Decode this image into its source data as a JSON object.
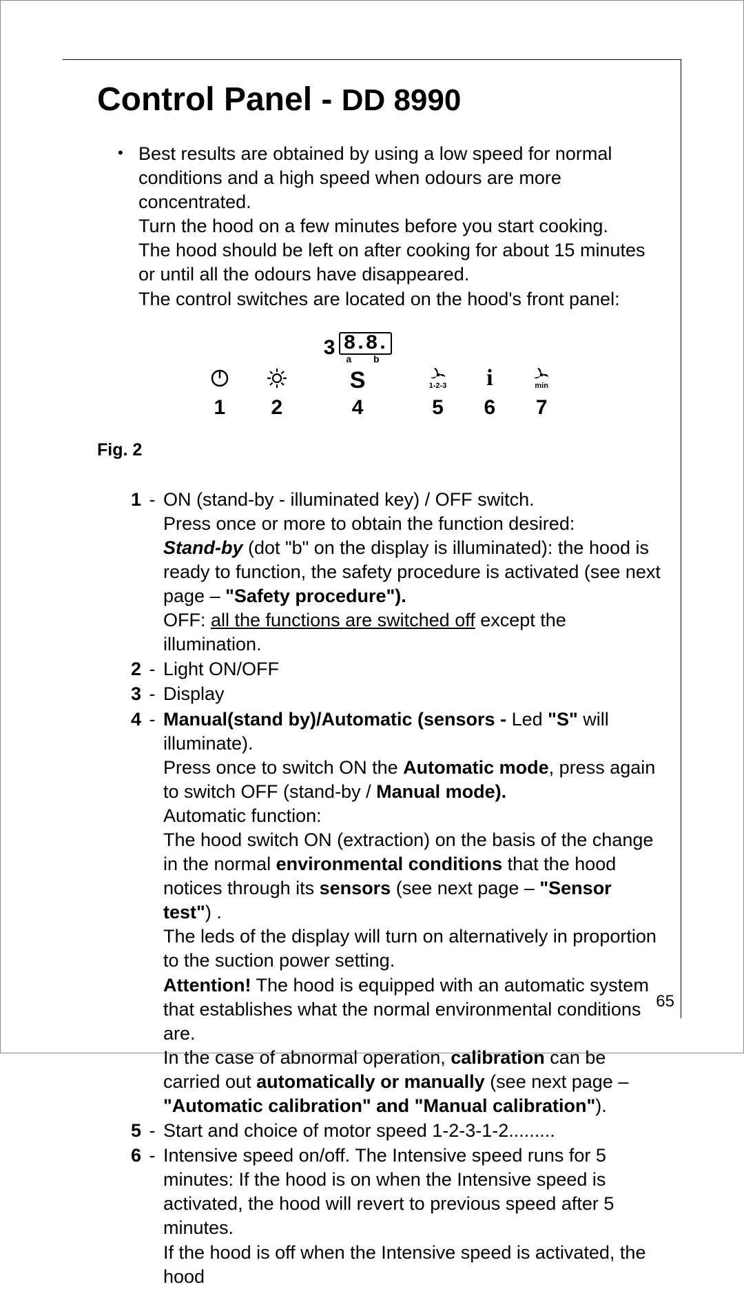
{
  "title_pre": "Control Panel - ",
  "title_model": "DD 8990",
  "intro": "Best results are obtained by using a low speed for normal conditions and a high speed when odours are more concentrated.\nTurn the hood on a few minutes before you start cooking.\nThe hood should be left on after cooking for about 15 minutes or until all the odours have disappeared.\nThe control switches are located on the hood's front panel:",
  "fig": {
    "display_segments": "8.8.",
    "ab": "a b",
    "labels": {
      "n1": "1",
      "n2": "2",
      "n3": "3",
      "n4": "4",
      "n5": "5",
      "n6": "6",
      "n7": "7"
    },
    "s": "S",
    "i": "i",
    "fan123": "1-2-3",
    "fanmin": "min"
  },
  "fig_caption": "Fig. 2",
  "items": {
    "1": {
      "num": "1",
      "l1": "ON (stand-by - illuminated key) / OFF switch.",
      "l2": "Press once or more to obtain the function desired:",
      "sb": "Stand-by",
      "l3a": " (dot \"b\" on the display is illuminated): the hood is ready to function, the safety procedure is activated (see next page – ",
      "sp": "\"Safety procedure\"",
      "l3b": ").",
      "off": "OFF: ",
      "offu": "all the functions are switched off",
      "off2": " except the illumination."
    },
    "2": {
      "num": "2",
      "text": "Light ON/OFF"
    },
    "3": {
      "num": "3",
      "text": "Display"
    },
    "4": {
      "num": "4",
      "b1": "Manual(stand by)/Automatic (sensors - ",
      "t1": "Led ",
      "b1s": "\"S\"",
      "t1b": " will illuminate).",
      "t2": "Press once to switch ON the ",
      "b2": "Automatic mode",
      "t2b": ", press again to switch OFF (stand-by / ",
      "b2c": "Manual mode).",
      "t3": "Automatic function:",
      "t4a": "The hood switch ON (extraction) on the basis of the change in the normal ",
      "b4": "environmental conditions",
      "t4b": " that the hood notices through its ",
      "b4s": "sensors",
      "t4c": " (see next page – ",
      "b4st": "\"Sensor test\"",
      "t4d": ") .",
      "t5": "The leds of the display will turn on alternatively in proportion to the suction power setting.",
      "batt": "Attention!",
      "t6": "  The hood is equipped with an automatic system that establishes what the normal environmental conditions are.",
      "t7a": "In the case of abnormal operation, ",
      "bcal": "calibration",
      "t7b": " can be carried out ",
      "bauto": "automatically or manually",
      "t7c": " (see next page – ",
      "bauto2": "\"Automatic calibration\" and \"Manual calibration\"",
      "t7d": ")."
    },
    "5": {
      "num": "5",
      "text": "Start and choice of motor speed 1-2-3-1-2........."
    },
    "6": {
      "num": "6",
      "l1": "Intensive speed on/off. The Intensive speed runs for 5 minutes: If the hood is on when the Intensive speed is activated, the hood will revert to previous speed after 5 minutes.",
      "l2": "If the hood is off when the Intensive speed is activated, the hood"
    }
  },
  "page_number": "65"
}
